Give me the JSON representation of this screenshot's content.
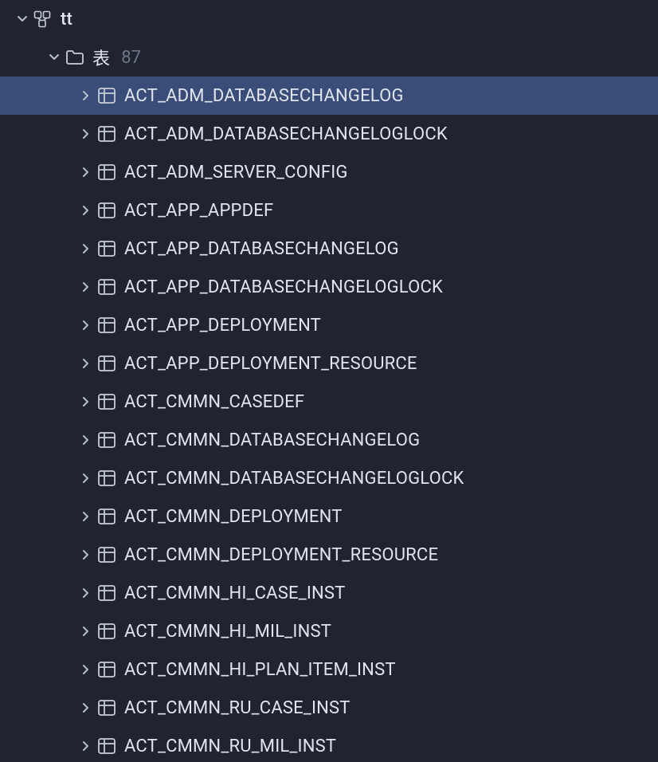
{
  "root": {
    "label": "tt",
    "expanded": true
  },
  "folder": {
    "label": "表",
    "count": "87",
    "expanded": true
  },
  "tables": [
    {
      "label": "ACT_ADM_DATABASECHANGELOG",
      "selected": true
    },
    {
      "label": "ACT_ADM_DATABASECHANGELOGLOCK",
      "selected": false
    },
    {
      "label": "ACT_ADM_SERVER_CONFIG",
      "selected": false
    },
    {
      "label": "ACT_APP_APPDEF",
      "selected": false
    },
    {
      "label": "ACT_APP_DATABASECHANGELOG",
      "selected": false
    },
    {
      "label": "ACT_APP_DATABASECHANGELOGLOCK",
      "selected": false
    },
    {
      "label": "ACT_APP_DEPLOYMENT",
      "selected": false
    },
    {
      "label": "ACT_APP_DEPLOYMENT_RESOURCE",
      "selected": false
    },
    {
      "label": "ACT_CMMN_CASEDEF",
      "selected": false
    },
    {
      "label": "ACT_CMMN_DATABASECHANGELOG",
      "selected": false
    },
    {
      "label": "ACT_CMMN_DATABASECHANGELOGLOCK",
      "selected": false
    },
    {
      "label": "ACT_CMMN_DEPLOYMENT",
      "selected": false
    },
    {
      "label": "ACT_CMMN_DEPLOYMENT_RESOURCE",
      "selected": false
    },
    {
      "label": "ACT_CMMN_HI_CASE_INST",
      "selected": false
    },
    {
      "label": "ACT_CMMN_HI_MIL_INST",
      "selected": false
    },
    {
      "label": "ACT_CMMN_HI_PLAN_ITEM_INST",
      "selected": false
    },
    {
      "label": "ACT_CMMN_RU_CASE_INST",
      "selected": false
    },
    {
      "label": "ACT_CMMN_RU_MIL_INST",
      "selected": false
    }
  ]
}
